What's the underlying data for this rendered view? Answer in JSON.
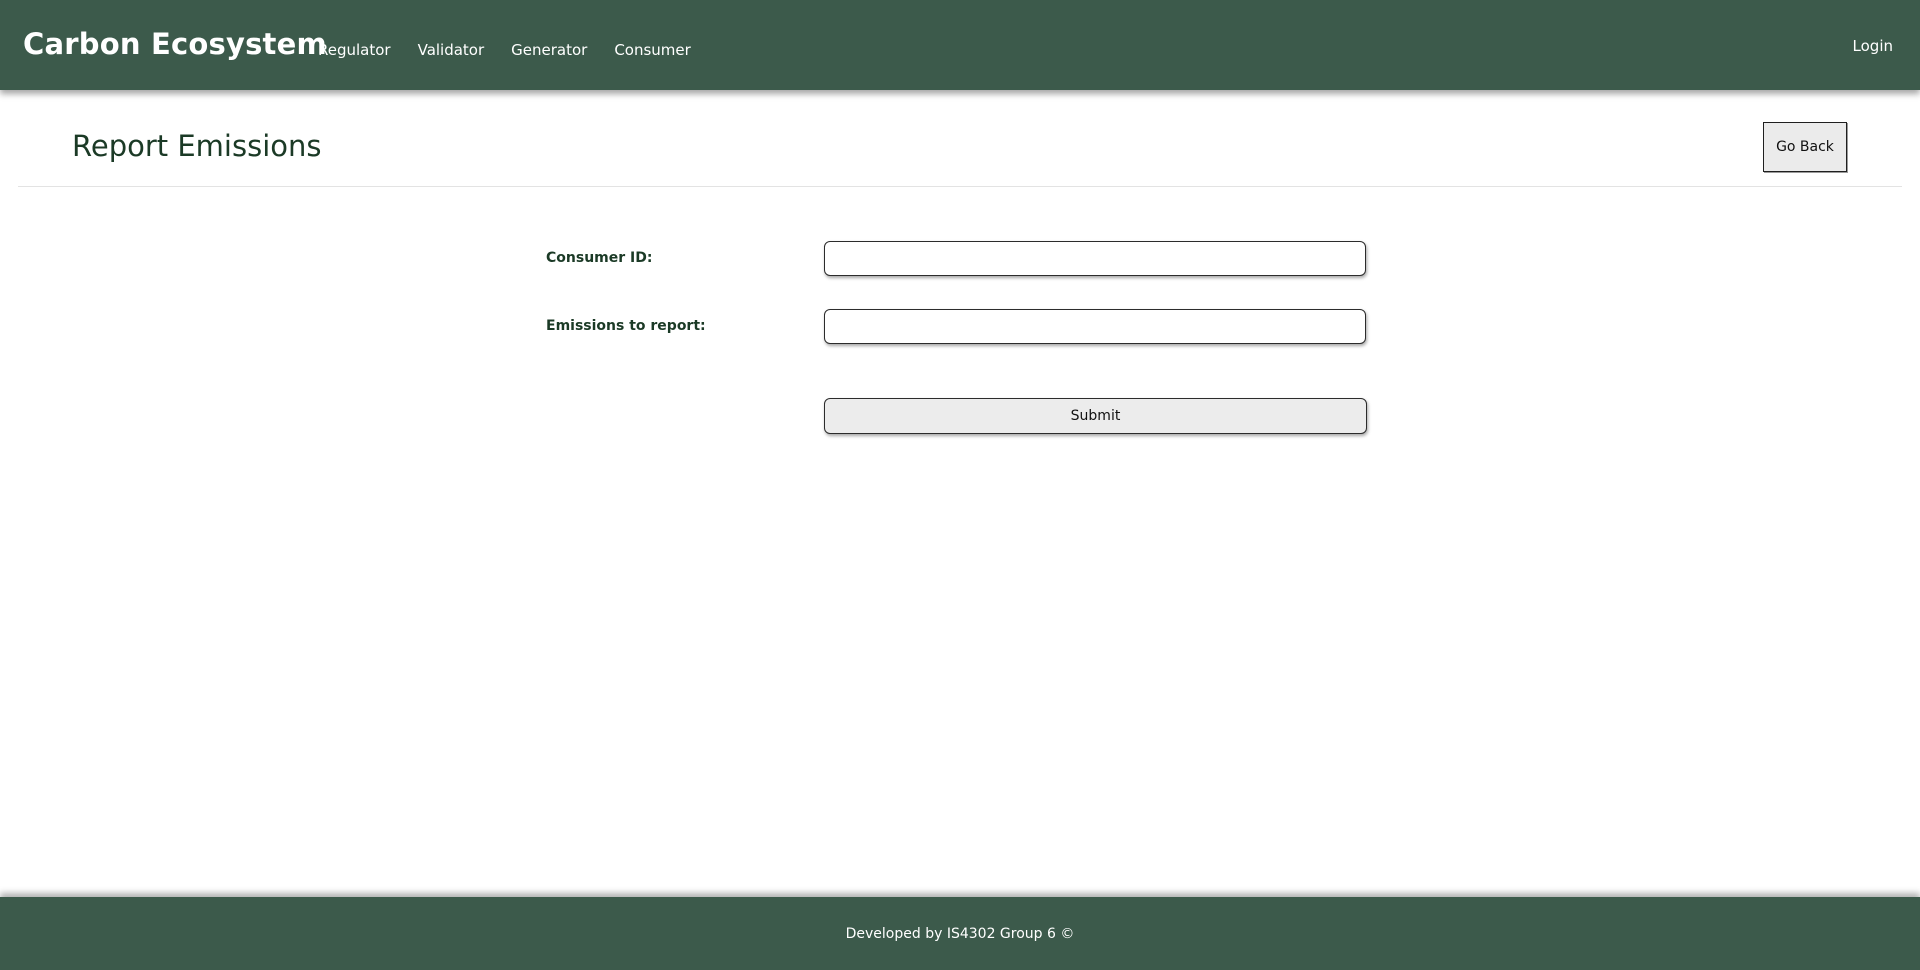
{
  "navbar": {
    "brand": "Carbon Ecosystem",
    "links": [
      "Regulator",
      "Validator",
      "Generator",
      "Consumer"
    ],
    "login": "Login"
  },
  "page": {
    "title": "Report Emissions",
    "go_back_label": "Go Back"
  },
  "form": {
    "consumer_id_label": "Consumer ID:",
    "consumer_id_value": "",
    "emissions_label": "Emissions to report:",
    "emissions_value": "",
    "submit_label": "Submit"
  },
  "footer": {
    "text": "Developed by IS4302 Group 6 ©"
  },
  "colors": {
    "header_bg": "#3c5a4b",
    "footer_bg": "#3c5a4b",
    "label_text": "#1b3a26",
    "button_bg": "#ececec"
  }
}
